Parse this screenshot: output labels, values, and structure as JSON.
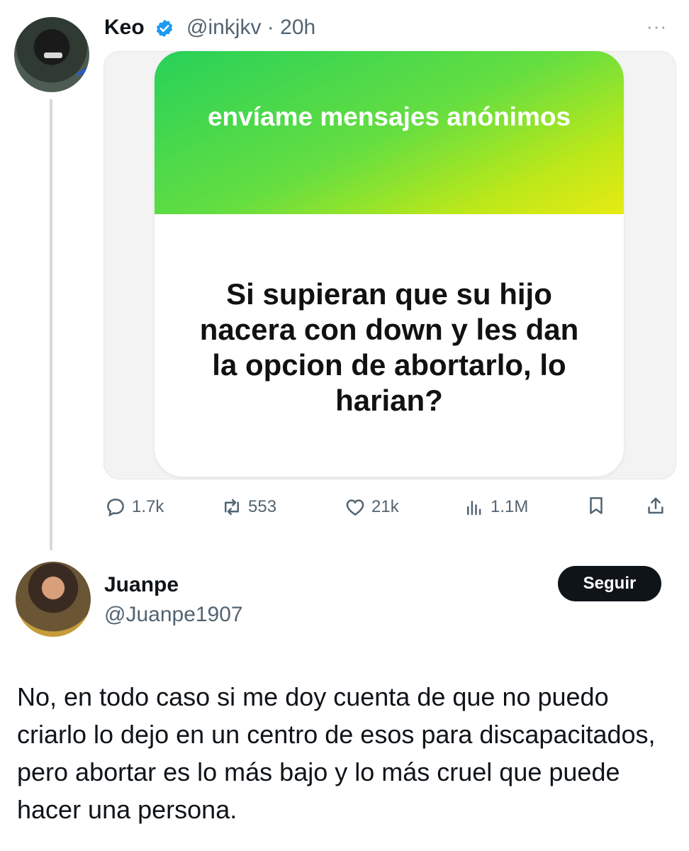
{
  "original_tweet": {
    "author_name": "Keo",
    "handle_time": "@inkjkv · 20h",
    "more_label": "···",
    "media": {
      "header_text": "envíame mensajes anónimos",
      "question": "Si supieran que su hijo nacera con down y les dan la opcion de abortarlo, lo harian?"
    },
    "actions": {
      "replies": "1.7k",
      "reposts": "553",
      "likes": "21k",
      "views": "1.1M"
    }
  },
  "reply": {
    "author_name": "Juanpe",
    "handle": "@Juanpe1907",
    "follow_label": "Seguir",
    "text": "No, en todo caso si me doy cuenta de que no puedo criarlo lo dejo en un centro de esos para discapacitados, pero abortar es lo más bajo y lo más cruel que puede hacer una persona."
  },
  "colors": {
    "verified": "#1d9bf0",
    "header_gradient_start": "#27d159",
    "header_gradient_end": "#e7ea13",
    "secondary_text": "#536471"
  }
}
